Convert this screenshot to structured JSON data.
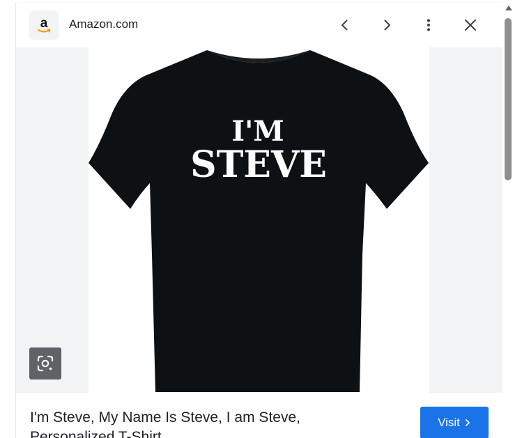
{
  "header": {
    "favicon_letter": "a",
    "site_name": "Amazon.com",
    "prev_icon": "chevron-left-icon",
    "next_icon": "chevron-right-icon",
    "more_icon": "more-vert-icon",
    "close_icon": "close-icon"
  },
  "image": {
    "shirt_text_line1": "I'M",
    "shirt_text_line2": "STEVE",
    "shirt_color": "#0e1113",
    "lens_icon": "google-lens-icon"
  },
  "result": {
    "title": "I'm Steve, My Name Is Steve, I am Steve, Personalized T-Shirt",
    "visit_label": "Visit"
  },
  "colors": {
    "accent": "#1a73e8",
    "background_side": "#f1f3f4"
  }
}
